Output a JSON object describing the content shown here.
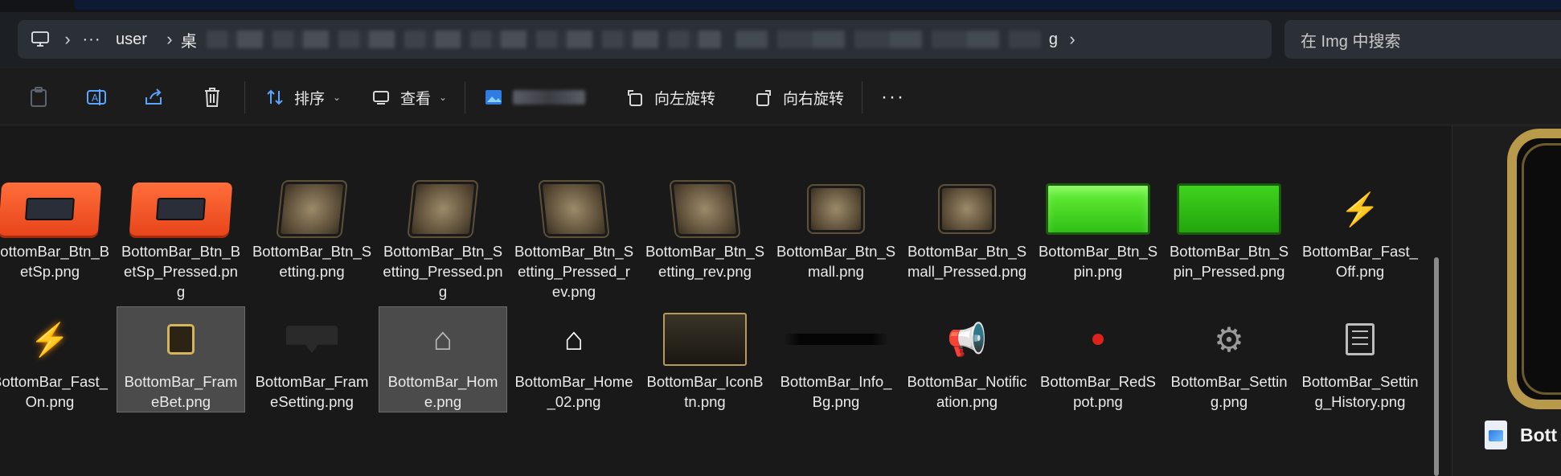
{
  "breadcrumb": {
    "pc_icon": "computer-icon",
    "more": "···",
    "user": "user",
    "first_visible": "桌",
    "tail": "g",
    "separator": "›"
  },
  "search": {
    "placeholder": "在 Img 中搜索"
  },
  "toolbar": {
    "sort_label": "排序",
    "view_label": "查看",
    "rotate_left_label": "向左旋转",
    "rotate_right_label": "向右旋转",
    "more": "···"
  },
  "files_row1": [
    {
      "name": "BottomBar_Btn_BetSp.png",
      "icon": "orange-button"
    },
    {
      "name": "BottomBar_Btn_BetSp_Pressed.png",
      "icon": "orange-button"
    },
    {
      "name": "BottomBar_Btn_Setting.png",
      "icon": "bronze-button"
    },
    {
      "name": "BottomBar_Btn_Setting_Pressed.png",
      "icon": "bronze-button"
    },
    {
      "name": "BottomBar_Btn_Setting_Pressed_rev.png",
      "icon": "bronze-button-rev"
    },
    {
      "name": "BottomBar_Btn_Setting_rev.png",
      "icon": "bronze-button-rev"
    },
    {
      "name": "BottomBar_Btn_Small.png",
      "icon": "bronze-small"
    },
    {
      "name": "BottomBar_Btn_Small_Pressed.png",
      "icon": "bronze-small"
    },
    {
      "name": "BottomBar_Btn_Spin.png",
      "icon": "green-button"
    },
    {
      "name": "BottomBar_Btn_Spin_Pressed.png",
      "icon": "green-button-pressed"
    },
    {
      "name": "BottomBar_Fast_Off.png",
      "icon": "bolt"
    }
  ],
  "files_row2": [
    {
      "name": "BottomBar_Fast_On.png",
      "icon": "bolt-on"
    },
    {
      "name": "BottomBar_FrameBet.png",
      "icon": "frame",
      "selected": true
    },
    {
      "name": "BottomBar_FrameSetting.png",
      "icon": "frame-setting"
    },
    {
      "name": "BottomBar_Home.png",
      "icon": "home",
      "selected": true
    },
    {
      "name": "BottomBar_Home_02.png",
      "icon": "home-white"
    },
    {
      "name": "BottomBar_IconBtn.png",
      "icon": "icon-button"
    },
    {
      "name": "BottomBar_Info_Bg.png",
      "icon": "info-bg"
    },
    {
      "name": "BottomBar_Notification.png",
      "icon": "megaphone"
    },
    {
      "name": "BottomBar_RedSpot.png",
      "icon": "red-dot"
    },
    {
      "name": "BottomBar_Setting.png",
      "icon": "gear"
    },
    {
      "name": "BottomBar_Setting_History.png",
      "icon": "document-list"
    }
  ],
  "preview": {
    "file_name": "Bott"
  },
  "colors": {
    "accent_gold": "#b89a4a",
    "selection": "#4b4b4b",
    "spin_green": "#3fd31e",
    "betsp_orange": "#ff6e3a"
  }
}
